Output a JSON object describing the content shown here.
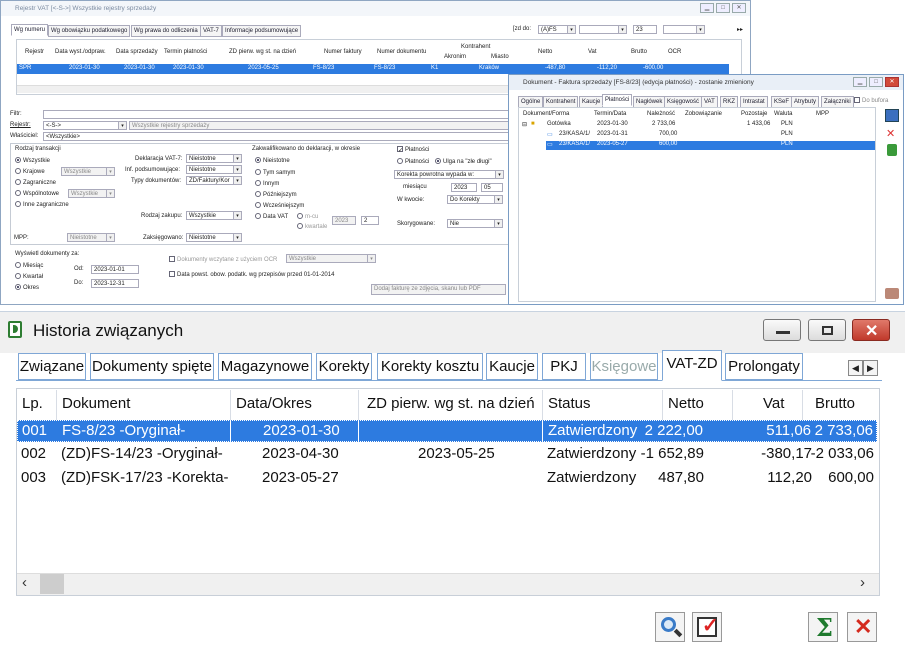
{
  "rejestr_window": {
    "title": "Rejestr VAT  [<-S->]  Wszystkie rejestry sprzedaży",
    "tabs": [
      "Wg numeru",
      "Wg obowiązku podatkowego",
      "Wg prawa do odliczenia",
      "VAT-7",
      "Informacje podsumowujące"
    ],
    "zd_label": "[zd do:",
    "zd_value": "(A)FS",
    "month_value": "23",
    "columns": [
      "Rejestr",
      "Data wyst./odpraw.",
      "Data sprzedaży",
      "Termin płatności",
      "ZD pierw. wg st. na dzień",
      "Numer faktury",
      "Numer dokumentu",
      "Kontrahent",
      "Akronim",
      "Miasto",
      "Netto",
      "Vat",
      "Brutto",
      "OCR"
    ],
    "row": {
      "rejestr": "SPR",
      "data_wyst": "2023-01-30",
      "data_sprz": "2023-01-30",
      "termin": "2023-01-30",
      "zd": "2023-05-25",
      "nr_faktury": "FS-8/23",
      "nr_dok": "FS-8/23",
      "akronim": "K1",
      "miasto": "Kraków",
      "netto": "-487,80",
      "vat": "-112,20",
      "brutto": "-600,00"
    },
    "filter": {
      "filtr_label": "Filtr:",
      "rejestr_label": "Rejestr:",
      "rejestr_value": "<-S->",
      "rejestr_desc": "Wszystkie rejestry sprzedaży",
      "wlasciciel_label": "Właściciel:",
      "wlasciciel_value": "<Wszystkie>"
    },
    "rodzaj": {
      "title": "Rodzaj transakcji",
      "opts": [
        "Wszystkie",
        "Krajowe",
        "Zagraniczne",
        "Wspólnotowe",
        "Inne zagraniczne"
      ],
      "krajowe_sel": "Wszystkie",
      "wspolnotowe_sel": "Wszystkie"
    },
    "deklaracja": {
      "vat7_label": "Deklaracja VAT-7:",
      "vat7": "Nieistotne",
      "inf_label": "Inf. podsumowujące:",
      "inf": "Nieistotne",
      "typy_label": "Typy dokumentów:",
      "typy": "ZD/Faktury/Kor",
      "rodzaj_zak_label": "Rodzaj zakupu:",
      "rodzaj_zak": "Wszystkie",
      "zaksieg_label": "Zaksięgowano:",
      "zaksieg": "Nieistotne",
      "mpp_label": "MPP:",
      "mpp": "Nieistotne"
    },
    "zakwal": {
      "title": "Zakwalifikowano do deklaracji, w okresie",
      "opts": [
        "Nieistotne",
        "Tym samym",
        "Innym",
        "Późniejszym",
        "Wcześniejszym",
        "Data VAT"
      ],
      "m_cu": "m-cu",
      "kwartale": "kwartale",
      "year": "2023",
      "num": "2"
    },
    "platnosci": {
      "title": "Płatności",
      "opt1": "Płatności",
      "opt2": "Ulga na \"złe długi\"",
      "korekta": "Korekta powrotna wypada w:",
      "miesiacu": "miesiącu",
      "year": "2023",
      "month": "05",
      "w_kwocie": "W kwocie:",
      "do_korekty": "Do Korekty",
      "skorygowane": "Skorygowane:",
      "skor_val": "Nie"
    },
    "wyswietl": {
      "title": "Wyświetl dokumenty za:",
      "opts": [
        "Miesiąc",
        "Kwartał",
        "Okres"
      ],
      "od_label": "Od:",
      "od": "2023-01-01",
      "do_label": "Do:",
      "do": "2023-12-31"
    },
    "ocr": {
      "label": "Dokumenty wczytane z użyciem OCR",
      "value": "Wszystkie",
      "data_powst": "Data powst. obow. podatk. wg przepisów przed 01-01-2014",
      "add_btn": "Dodaj fakturę ze zdjęcia, skanu lub PDF"
    }
  },
  "dokument_window": {
    "title": "Dokument - Faktura sprzedaży [FS-8/23] (edycja płatności) - zostanie zmieniony",
    "tabs": [
      "Ogólne",
      "Kontrahent",
      "Kaucje",
      "Płatności",
      "Nagłówek",
      "Księgowość",
      "VAT",
      "RKZ",
      "Intrastat",
      "KSeF",
      "Atrybuty",
      "Załączniki"
    ],
    "do_bufora": "Do bufora",
    "columns": [
      "Dokument/Forma",
      "Termin/Data",
      "Należność",
      "Zobowiązanie",
      "Pozostaje",
      "Waluta",
      "MPP"
    ],
    "rows": [
      {
        "doc": "Gotówka",
        "date": "2023-01-30",
        "nal": "2 733,06",
        "zob": "",
        "poz": "1 433,06",
        "wal": "PLN"
      },
      {
        "doc": "23/KASA/1/",
        "date": "2023-01-31",
        "nal": "700,00",
        "zob": "",
        "poz": "",
        "wal": "PLN"
      },
      {
        "doc": "23/KASA/1/",
        "date": "2023-05-27",
        "nal": "600,00",
        "zob": "",
        "poz": "",
        "wal": "PLN"
      }
    ]
  },
  "historia": {
    "title": "Historia związanych",
    "tabs": [
      "Związane",
      "Dokumenty spięte",
      "Magazynowe",
      "Korekty",
      "Korekty kosztu",
      "Kaucje",
      "PKJ",
      "Księgowe",
      "VAT-ZD",
      "Prolongaty"
    ],
    "columns": [
      "Lp.",
      "Dokument",
      "Data/Okres",
      "ZD pierw. wg st. na dzień",
      "Status",
      "Netto",
      "Vat",
      "Brutto"
    ],
    "rows": [
      {
        "lp": "001",
        "dok": "FS-8/23 -Oryginał-",
        "data": "2023-01-30",
        "zd": "",
        "status": "Zatwierdzony",
        "netto": "2 222,00",
        "vat": "511,06",
        "brutto": "2 733,06"
      },
      {
        "lp": "002",
        "dok": "(ZD)FS-14/23 -Oryginał-",
        "data": "2023-04-30",
        "zd": "2023-05-25",
        "status": "Zatwierdzony",
        "netto": "-1 652,89",
        "vat": "-380,17",
        "brutto": "-2 033,06"
      },
      {
        "lp": "003",
        "dok": "(ZD)FSK-17/23 -Korekta-",
        "data": "2023-05-27",
        "zd": "",
        "status": "Zatwierdzony",
        "netto": "487,80",
        "vat": "112,20",
        "brutto": "600,00"
      }
    ]
  }
}
